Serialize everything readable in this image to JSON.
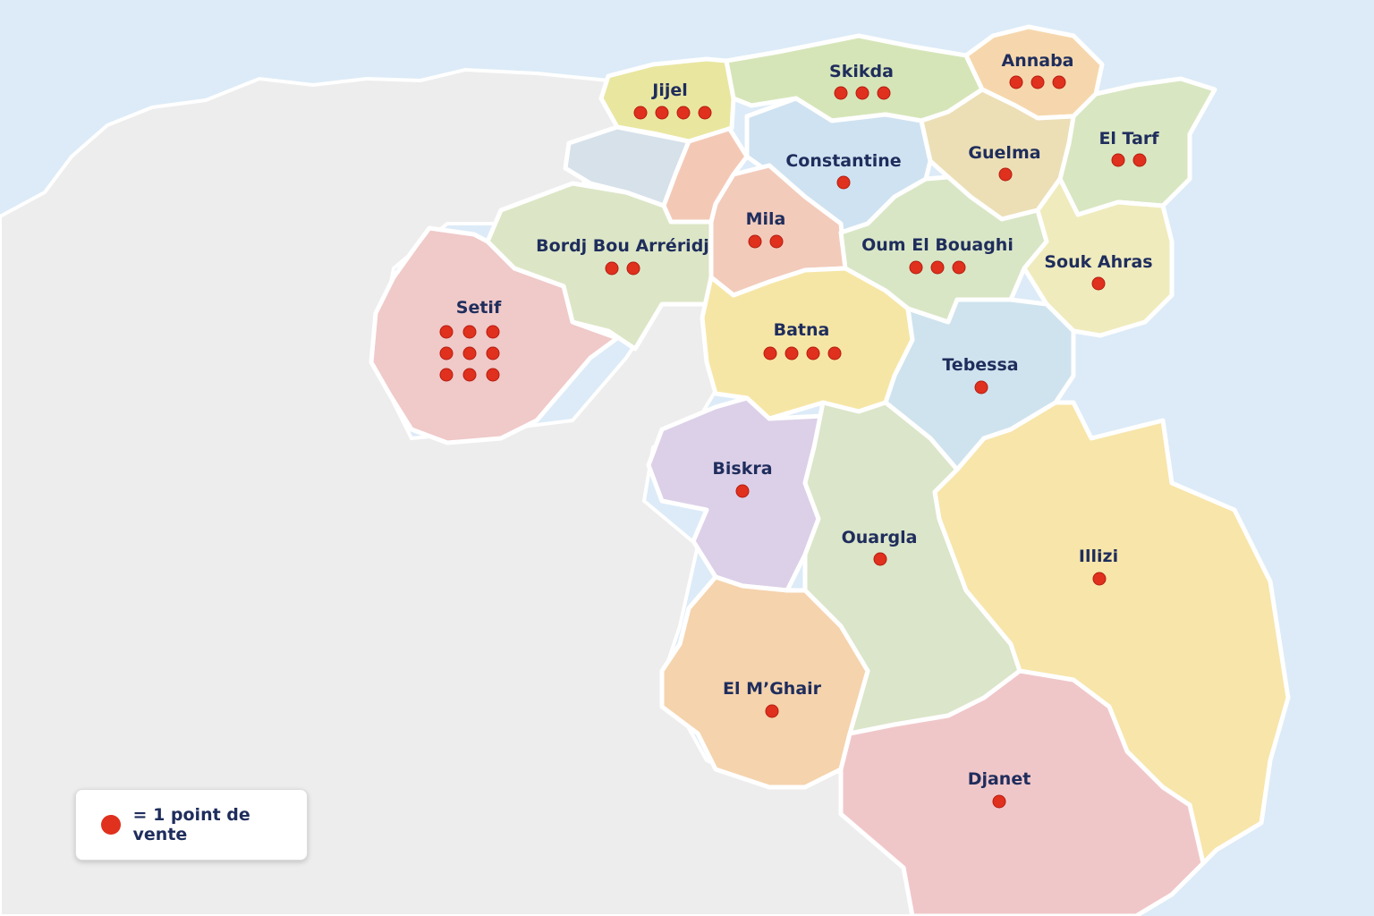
{
  "colors": {
    "sea": "#dcebf7",
    "land": "#ededed",
    "dot": "#e0301e",
    "label": "#1f2d5c"
  },
  "legend": {
    "text": "= 1 point de vente"
  },
  "regions": [
    {
      "id": "jijel",
      "name": "Jijel",
      "points": 4,
      "fill": "#e9e6a0"
    },
    {
      "id": "skikda",
      "name": "Skikda",
      "points": 3,
      "fill": "#d6e5b8"
    },
    {
      "id": "annaba",
      "name": "Annaba",
      "points": 3,
      "fill": "#f6d7ad"
    },
    {
      "id": "el-tarf",
      "name": "El Tarf",
      "points": 2,
      "fill": "#d9e6c2"
    },
    {
      "id": "constantine",
      "name": "Constantine",
      "points": 1,
      "fill": "#cfe2f1"
    },
    {
      "id": "guelma",
      "name": "Guelma",
      "points": 1,
      "fill": "#ecdfb6"
    },
    {
      "id": "mila",
      "name": "Mila",
      "points": 2,
      "fill": "#f2cbbb"
    },
    {
      "id": "oum-el-bouaghi",
      "name": "Oum El Bouaghi",
      "points": 3,
      "fill": "#d9e6c6"
    },
    {
      "id": "souk-ahras",
      "name": "Souk Ahras",
      "points": 1,
      "fill": "#efebbd"
    },
    {
      "id": "bordj-bou-arreridj",
      "name": "Bordj Bou Arréridj",
      "points": 2,
      "fill": "#dce6c6"
    },
    {
      "id": "setif",
      "name": "Setif",
      "points": 9,
      "fill": "#f0c9c9"
    },
    {
      "id": "batna",
      "name": "Batna",
      "points": 4,
      "fill": "#f6e6a6"
    },
    {
      "id": "tebessa",
      "name": "Tebessa",
      "points": 1,
      "fill": "#cfe3ee"
    },
    {
      "id": "biskra",
      "name": "Biskra",
      "points": 1,
      "fill": "#dcd0e8"
    },
    {
      "id": "ouargla",
      "name": "Ouargla",
      "points": 1,
      "fill": "#dbe5c9"
    },
    {
      "id": "illizi",
      "name": "Illizi",
      "points": 1,
      "fill": "#f7e5aa"
    },
    {
      "id": "el-mghair",
      "name": "El M’Ghair",
      "points": 1,
      "fill": "#f5d3ad"
    },
    {
      "id": "djanet",
      "name": "Djanet",
      "points": 1,
      "fill": "#f0c7c9"
    },
    {
      "id": "unnamed-1",
      "name": "",
      "points": 0,
      "fill": "#d6e1ea"
    },
    {
      "id": "unnamed-2",
      "name": "",
      "points": 0,
      "fill": "#f3c9b6"
    }
  ]
}
